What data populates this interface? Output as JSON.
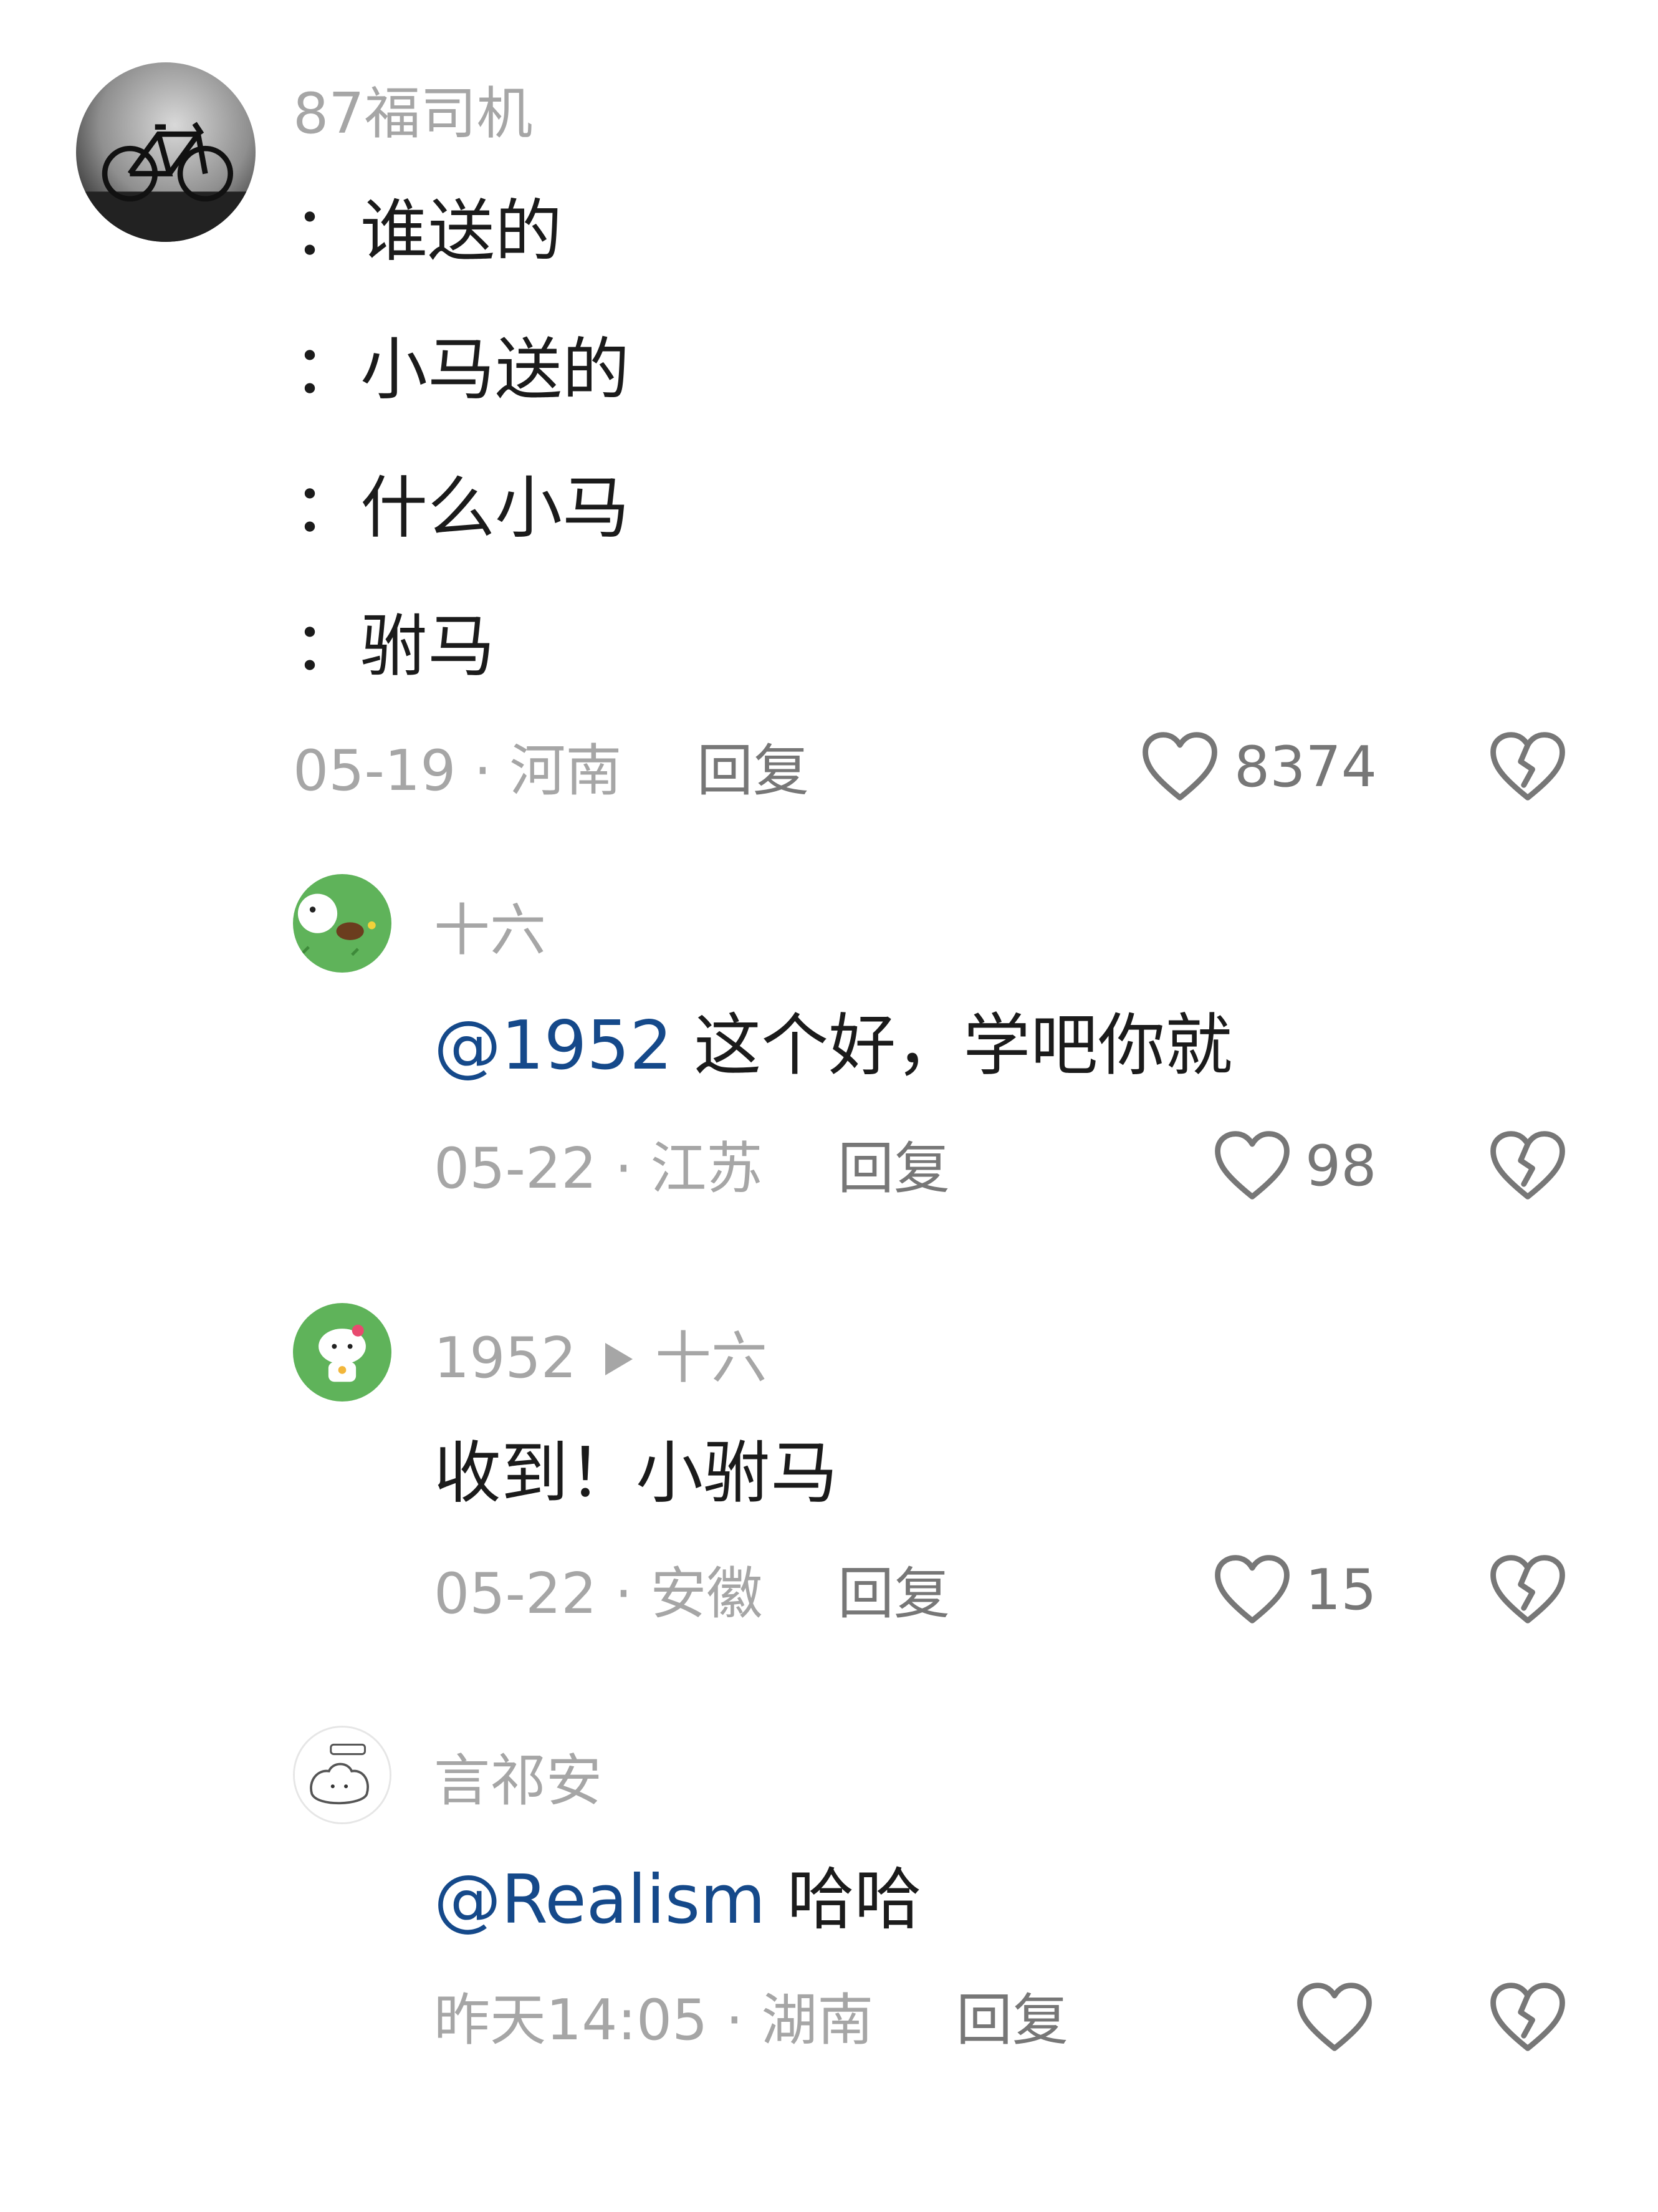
{
  "comments": [
    {
      "username": "87福司机",
      "lines": [
        "：谁送的",
        "：小马送的",
        "：什么小马",
        "：驸马"
      ],
      "date": "05-19",
      "location": "河南",
      "reply_label": "回复",
      "likes": "8374"
    },
    {
      "username": "十六",
      "mention": "@1952",
      "text": " 这个好，学吧你就",
      "date": "05-22",
      "location": "江苏",
      "reply_label": "回复",
      "likes": "98"
    },
    {
      "username": "1952",
      "reply_to": "十六",
      "text": "收到！小驸马",
      "date": "05-22",
      "location": "安徽",
      "reply_label": "回复",
      "likes": "15"
    },
    {
      "username": "言祁安",
      "mention": "@Realism",
      "text": " 哈哈",
      "date": "昨天14:05",
      "location": "湖南",
      "reply_label": "回复",
      "likes": ""
    }
  ],
  "meta_separator": " · ",
  "icons": {
    "like": "heart-outline-icon",
    "dislike": "broken-heart-icon",
    "reply_arrow": "triangle-right-icon"
  },
  "colors": {
    "mention": "#15498a",
    "secondary_text": "#a6a6a6",
    "icon_gray": "#777777"
  }
}
